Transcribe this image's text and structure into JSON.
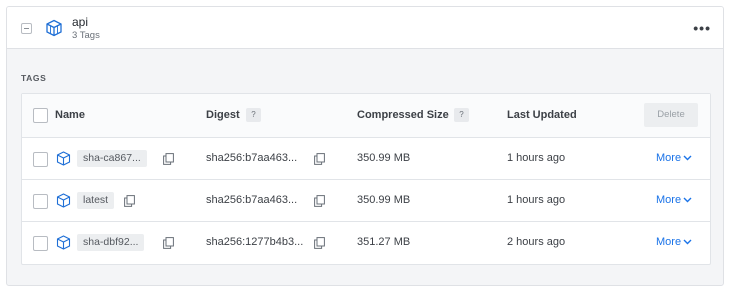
{
  "repository": {
    "name": "api",
    "tag_count": "3 Tags"
  },
  "section_label": "TAGS",
  "table": {
    "headers": {
      "name": "Name",
      "digest": "Digest",
      "digest_help": "?",
      "size": "Compressed Size",
      "size_help": "?",
      "updated": "Last Updated",
      "delete": "Delete"
    },
    "rows": [
      {
        "tag": "sha-ca867...",
        "digest": "sha256:b7aa463...",
        "size": "350.99 MB",
        "updated": "1 hours ago",
        "more": "More"
      },
      {
        "tag": "latest",
        "digest": "sha256:b7aa463...",
        "size": "350.99 MB",
        "updated": "1 hours ago",
        "more": "More"
      },
      {
        "tag": "sha-dbf92...",
        "digest": "sha256:1277b4b3...",
        "size": "351.27 MB",
        "updated": "2 hours ago",
        "more": "More"
      }
    ]
  },
  "icons": {
    "collapse": "collapse-minus-icon",
    "repository": "cube-icon",
    "menu": "kebab-menu-icon",
    "copy": "copy-icon",
    "chevron": "chevron-down-icon"
  },
  "colors": {
    "link": "#1a73e8",
    "icon_blue": "#1f6fd6"
  }
}
